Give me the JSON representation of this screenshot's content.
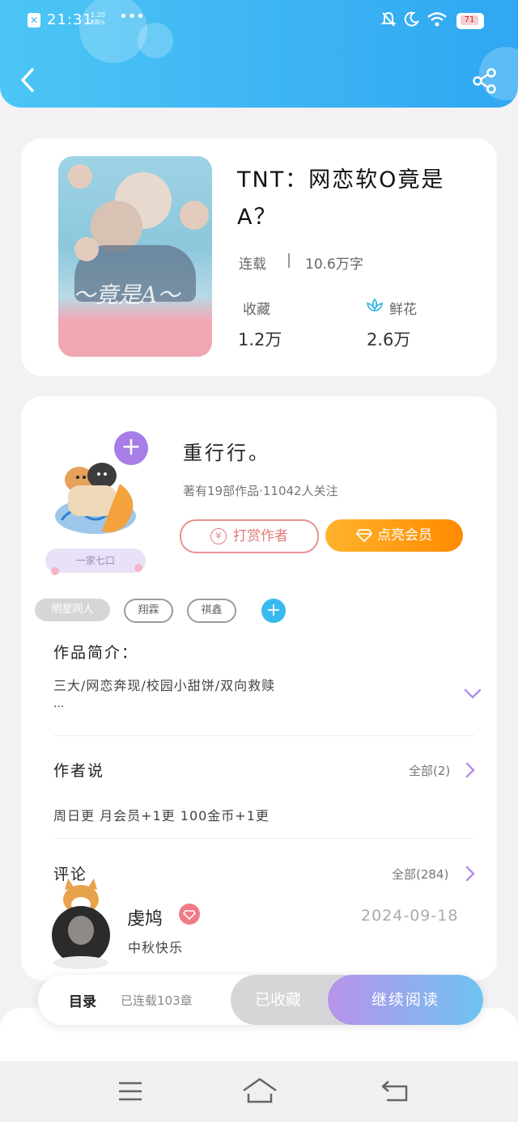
{
  "status_bar": {
    "time": "21:31",
    "net_speed_value": "1.20",
    "net_speed_unit": "KB/s",
    "more": "•••",
    "battery": "71"
  },
  "book": {
    "title": "TNT：网恋软O竟是A？",
    "status": "连载",
    "word_count": "10.6万字",
    "favorites_label": "收藏",
    "favorites_value": "1.2万",
    "flowers_label": "鲜花",
    "flowers_value": "2.6万"
  },
  "author": {
    "name": "重行行。",
    "meta": "著有19部作品·11042人关注",
    "badge_text": "一家七口",
    "tip_button": "打赏作者",
    "vip_button": "点亮会员",
    "plus": "+"
  },
  "tags": [
    "明星同人",
    "翔霖",
    "祺鑫"
  ],
  "intro": {
    "title": "作品简介：",
    "text": "三大/网恋奔现/校园小甜饼/双向救赎",
    "ellipsis": "..."
  },
  "author_says": {
    "title": "作者说",
    "all_link": "全部(2)",
    "text": "周日更 月会员+1更 100金币+1更"
  },
  "comments": {
    "title": "评论",
    "all_link": "全部(284)",
    "items": [
      {
        "user": "虔鸠",
        "date": "2024-09-18",
        "text": "中秋快乐"
      }
    ]
  },
  "action_bar": {
    "catalog_label": "目录",
    "chapters": "已连载103章",
    "collected": "已收藏",
    "continue": "继续阅读"
  },
  "colors": {
    "header_blue": "#3bb3f3",
    "purple": "#a77ee8",
    "orange": "#ff8a00",
    "tip_red": "#e27b78"
  }
}
